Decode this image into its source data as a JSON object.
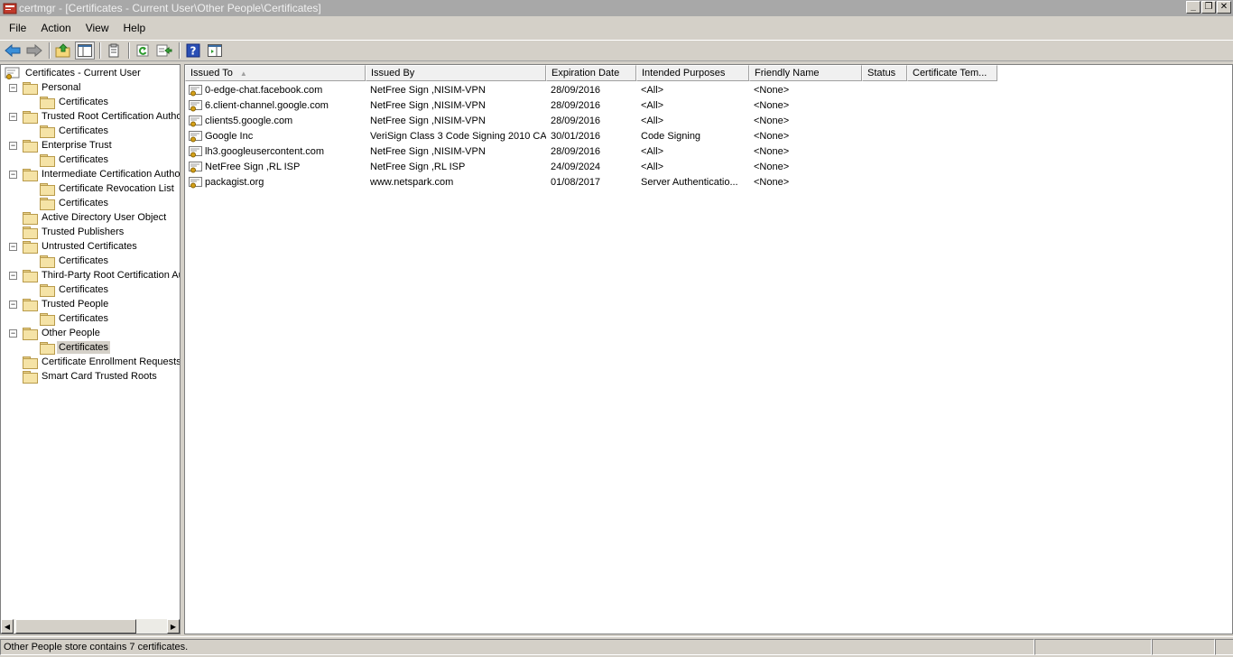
{
  "window": {
    "title": "certmgr - [Certificates - Current User\\Other People\\Certificates]",
    "controls": {
      "minimize": "_",
      "restore": "❐",
      "close": "✕"
    }
  },
  "menu": {
    "items": [
      "File",
      "Action",
      "View",
      "Help"
    ]
  },
  "toolbar": {
    "buttons": [
      "back-icon",
      "forward-icon",
      "up-folder-icon",
      "show-hide-tree-icon",
      "properties-icon",
      "refresh-icon",
      "export-list-icon",
      "help-icon",
      "show-action-pane-icon"
    ]
  },
  "tree": {
    "root": "Certificates - Current User",
    "items": [
      {
        "label": "Personal",
        "level": 1,
        "toggle": "−"
      },
      {
        "label": "Certificates",
        "level": 2
      },
      {
        "label": "Trusted Root Certification Authorities",
        "level": 1,
        "toggle": "−"
      },
      {
        "label": "Certificates",
        "level": 2
      },
      {
        "label": "Enterprise Trust",
        "level": 1,
        "toggle": "−"
      },
      {
        "label": "Certificates",
        "level": 2
      },
      {
        "label": "Intermediate Certification Authorities",
        "level": 1,
        "toggle": "−"
      },
      {
        "label": "Certificate Revocation List",
        "level": 2
      },
      {
        "label": "Certificates",
        "level": 2
      },
      {
        "label": "Active Directory User Object",
        "level": 1
      },
      {
        "label": "Trusted Publishers",
        "level": 1
      },
      {
        "label": "Untrusted Certificates",
        "level": 1,
        "toggle": "−"
      },
      {
        "label": "Certificates",
        "level": 2
      },
      {
        "label": "Third-Party Root Certification Authorities",
        "level": 1,
        "toggle": "−"
      },
      {
        "label": "Certificates",
        "level": 2
      },
      {
        "label": "Trusted People",
        "level": 1,
        "toggle": "−"
      },
      {
        "label": "Certificates",
        "level": 2
      },
      {
        "label": "Other People",
        "level": 1,
        "toggle": "−"
      },
      {
        "label": "Certificates",
        "level": 2,
        "selected": true
      },
      {
        "label": "Certificate Enrollment Requests",
        "level": 1
      },
      {
        "label": "Smart Card Trusted Roots",
        "level": 1
      }
    ]
  },
  "list": {
    "columns": [
      "Issued To",
      "Issued By",
      "Expiration Date",
      "Intended Purposes",
      "Friendly Name",
      "Status",
      "Certificate Tem..."
    ],
    "rows": [
      [
        "0-edge-chat.facebook.com",
        "NetFree Sign ,NISIM-VPN",
        "28/09/2016",
        "<All>",
        "<None>",
        "",
        ""
      ],
      [
        "6.client-channel.google.com",
        "NetFree Sign ,NISIM-VPN",
        "28/09/2016",
        "<All>",
        "<None>",
        "",
        ""
      ],
      [
        "clients5.google.com",
        "NetFree Sign ,NISIM-VPN",
        "28/09/2016",
        "<All>",
        "<None>",
        "",
        ""
      ],
      [
        "Google Inc",
        "VeriSign Class 3 Code Signing 2010 CA",
        "30/01/2016",
        "Code Signing",
        "<None>",
        "",
        ""
      ],
      [
        "lh3.googleusercontent.com",
        "NetFree Sign ,NISIM-VPN",
        "28/09/2016",
        "<All>",
        "<None>",
        "",
        ""
      ],
      [
        "NetFree Sign ,RL ISP",
        "NetFree Sign ,RL ISP",
        "24/09/2024",
        "<All>",
        "<None>",
        "",
        ""
      ],
      [
        "packagist.org",
        "www.netspark.com",
        "01/08/2017",
        "Server Authenticatio...",
        "<None>",
        "",
        ""
      ]
    ]
  },
  "status": {
    "text": "Other People store contains 7 certificates."
  }
}
